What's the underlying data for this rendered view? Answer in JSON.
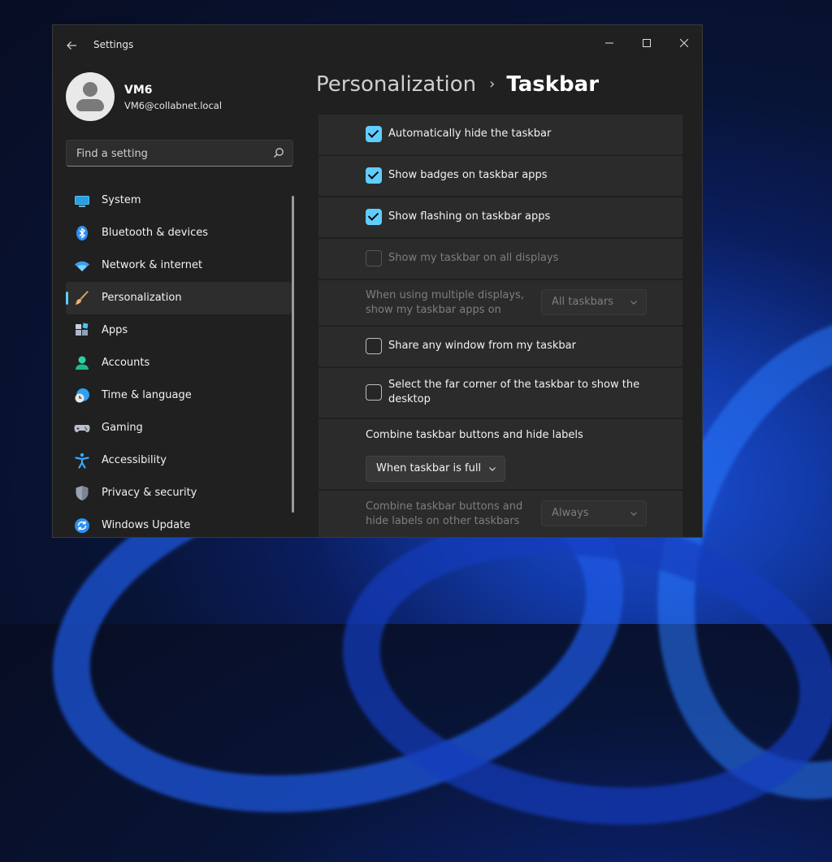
{
  "window": {
    "title": "Settings",
    "controls": {
      "minimize": "—",
      "maximize": "☐",
      "close": "✕"
    }
  },
  "profile": {
    "name": "VM6",
    "email": "VM6@collabnet.local"
  },
  "search": {
    "placeholder": "Find a setting"
  },
  "nav": {
    "items": [
      {
        "label": "System",
        "icon": "system-icon"
      },
      {
        "label": "Bluetooth & devices",
        "icon": "bluetooth-icon"
      },
      {
        "label": "Network & internet",
        "icon": "wifi-icon"
      },
      {
        "label": "Personalization",
        "icon": "brush-icon",
        "selected": true
      },
      {
        "label": "Apps",
        "icon": "apps-icon"
      },
      {
        "label": "Accounts",
        "icon": "accounts-icon"
      },
      {
        "label": "Time & language",
        "icon": "globe-clock-icon"
      },
      {
        "label": "Gaming",
        "icon": "gamepad-icon"
      },
      {
        "label": "Accessibility",
        "icon": "accessibility-icon"
      },
      {
        "label": "Privacy & security",
        "icon": "shield-icon"
      },
      {
        "label": "Windows Update",
        "icon": "update-icon"
      }
    ]
  },
  "breadcrumb": {
    "parent": "Personalization",
    "separator": "›",
    "current": "Taskbar"
  },
  "settings": {
    "auto_hide": {
      "label": "Automatically hide the taskbar",
      "checked": true
    },
    "badges": {
      "label": "Show badges on taskbar apps",
      "checked": true
    },
    "flashing": {
      "label": "Show flashing on taskbar apps",
      "checked": true
    },
    "all_displays": {
      "label": "Show my taskbar on all displays",
      "checked": false,
      "disabled": true
    },
    "multi_display": {
      "label": "When using multiple displays, show my taskbar apps on",
      "value": "All taskbars",
      "disabled": true
    },
    "share_window": {
      "label": "Share any window from my taskbar",
      "checked": false
    },
    "far_corner": {
      "label": "Select the far corner of the taskbar to show the desktop",
      "checked": false
    },
    "combine": {
      "label": "Combine taskbar buttons and hide labels",
      "value": "When taskbar is full"
    },
    "combine_other": {
      "label": "Combine taskbar buttons and hide labels on other taskbars",
      "value": "Always",
      "disabled": true
    }
  },
  "colors": {
    "accent": "#60cdff",
    "window_bg": "#202020",
    "card_bg": "#2b2b2b"
  }
}
